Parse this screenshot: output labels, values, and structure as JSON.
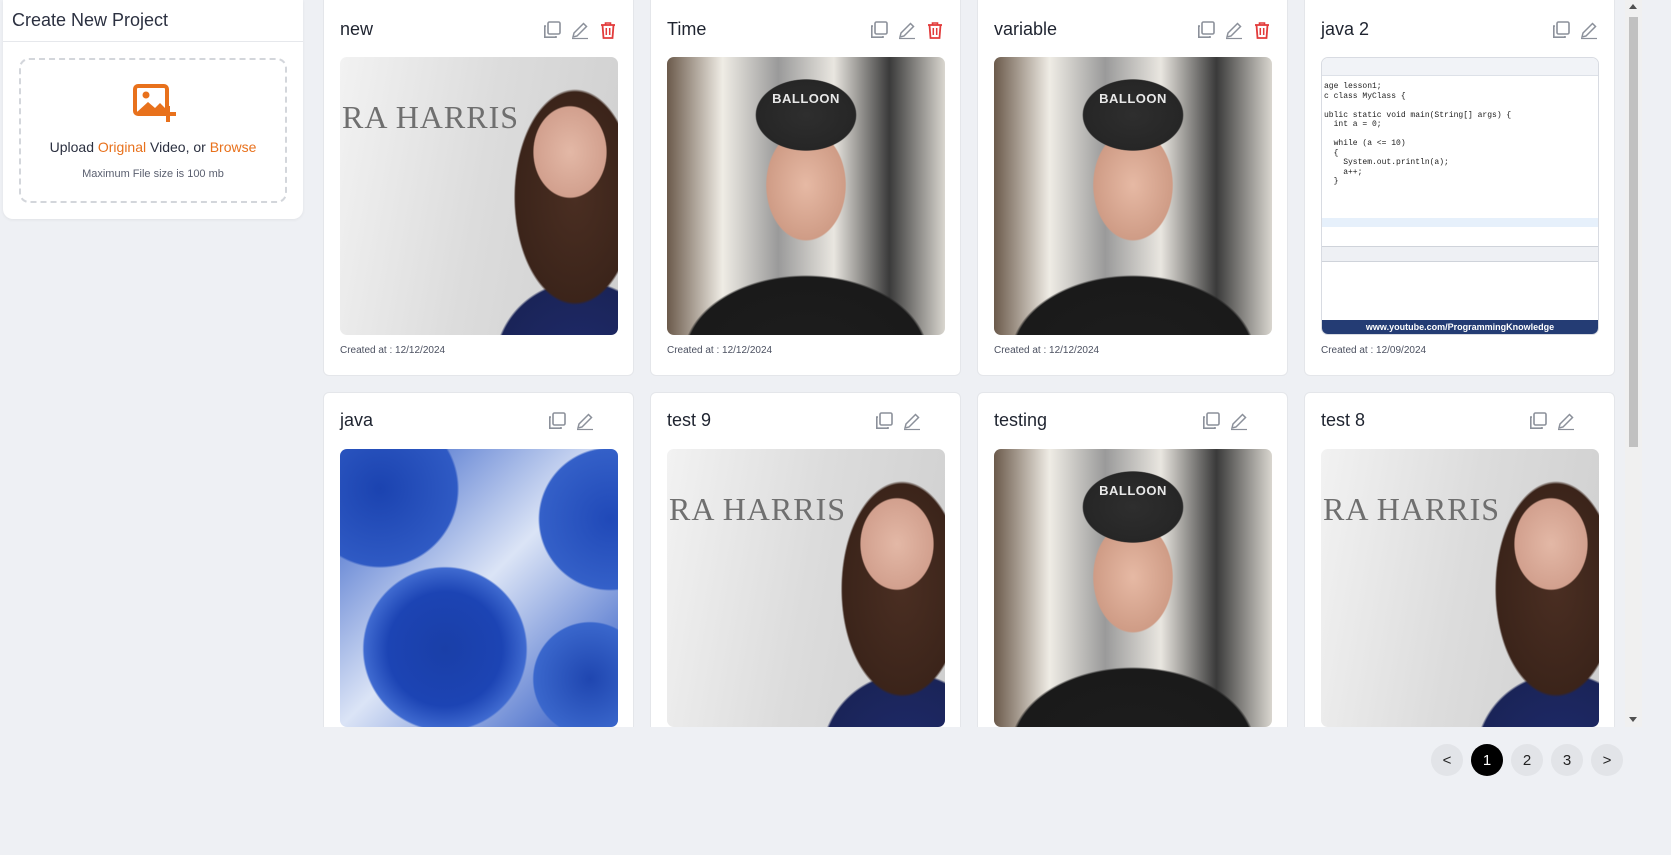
{
  "create_panel": {
    "title": "Create New Project",
    "upload_prefix": "Upload ",
    "upload_original": "Original",
    "upload_middle": " Video, or ",
    "upload_browse": "Browse",
    "hint": "Maximum File size is 100 mb",
    "accent_color": "#e8711c"
  },
  "projects": [
    {
      "title": "new",
      "created": "Created at : 12/12/2024",
      "thumbnail": "woman-harris",
      "thumb_text": "RA HARRIS",
      "deletable": true
    },
    {
      "title": "Time",
      "created": "Created at : 12/12/2024",
      "thumbnail": "man-cap",
      "thumb_text": "BALLOON",
      "deletable": true
    },
    {
      "title": "variable",
      "created": "Created at : 12/12/2024",
      "thumbnail": "man-cap",
      "thumb_text": "BALLOON",
      "deletable": true
    },
    {
      "title": "java 2",
      "created": "Created at : 12/09/2024",
      "thumbnail": "java-code",
      "thumb_text": "www.youtube.com/ProgrammingKnowledge",
      "deletable": false
    },
    {
      "title": "java",
      "created": "",
      "thumbnail": "blue-wallpaper",
      "deletable": false
    },
    {
      "title": "test 9",
      "created": "",
      "thumbnail": "woman-harris",
      "thumb_text": "RA HARRIS",
      "deletable": false
    },
    {
      "title": "testing",
      "created": "",
      "thumbnail": "man-cap",
      "thumb_text": "BALLOON",
      "deletable": false
    },
    {
      "title": "test 8",
      "created": "",
      "thumbnail": "woman-harris",
      "thumb_text": "RA HARRIS",
      "deletable": false
    }
  ],
  "code_lines": [
    "age lesson1;",
    "c class MyClass {",
    "",
    "ublic static void main(String[] args) {",
    "  int a = 0;",
    "",
    "  while (a <= 10)",
    "  {",
    "    System.out.println(a);",
    "    a++;",
    "  }"
  ],
  "pagination": {
    "prev": "<",
    "pages": [
      "1",
      "2",
      "3"
    ],
    "active": "1",
    "next": ">"
  },
  "colors": {
    "delete_icon": "#e23b3b",
    "icon_gray": "#8b909a",
    "active_page": "#000000"
  }
}
